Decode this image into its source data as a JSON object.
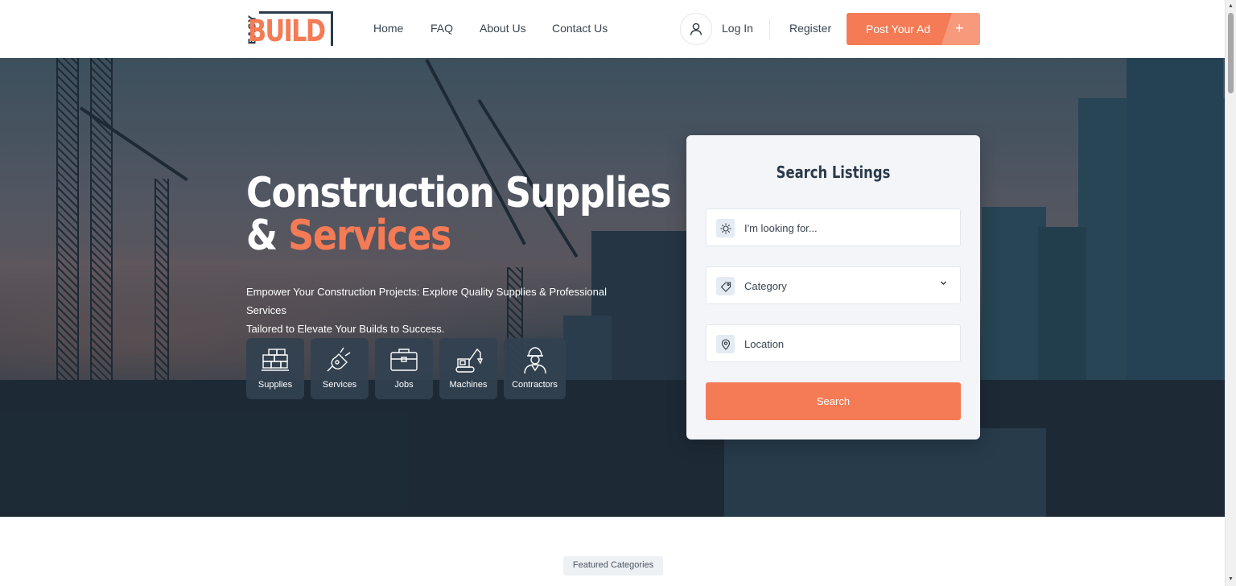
{
  "brand": {
    "logo_small": "EASY",
    "logo_large": "BUILD"
  },
  "nav": {
    "home": "Home",
    "faq": "FAQ",
    "about": "About Us",
    "contact": "Contact Us"
  },
  "account": {
    "login": "Log In",
    "register": "Register",
    "post_ad": "Post Your Ad",
    "post_ad_icon": "+"
  },
  "hero": {
    "title_line1": "Construction Supplies",
    "title_amp": "&",
    "title_accent": "Services",
    "subtitle_line1": "Empower Your Construction Projects: Explore Quality Supplies & Professional Services",
    "subtitle_line2": "Tailored to Elevate Your Builds to Success.",
    "categories": [
      {
        "label": "Supplies",
        "icon": "bricks-icon"
      },
      {
        "label": "Services",
        "icon": "plug-icon"
      },
      {
        "label": "Jobs",
        "icon": "briefcase-icon"
      },
      {
        "label": "Machines",
        "icon": "excavator-icon"
      },
      {
        "label": "Contractors",
        "icon": "worker-icon"
      }
    ]
  },
  "search": {
    "title": "Search Listings",
    "keyword_placeholder": "I'm looking for...",
    "category_placeholder": "Category",
    "location_placeholder": "Location",
    "button": "Search"
  },
  "featured": {
    "badge": "Featured Categories"
  },
  "colors": {
    "accent": "#f47b55",
    "dark": "#2b3a4a",
    "panel": "#f3f5f8"
  }
}
